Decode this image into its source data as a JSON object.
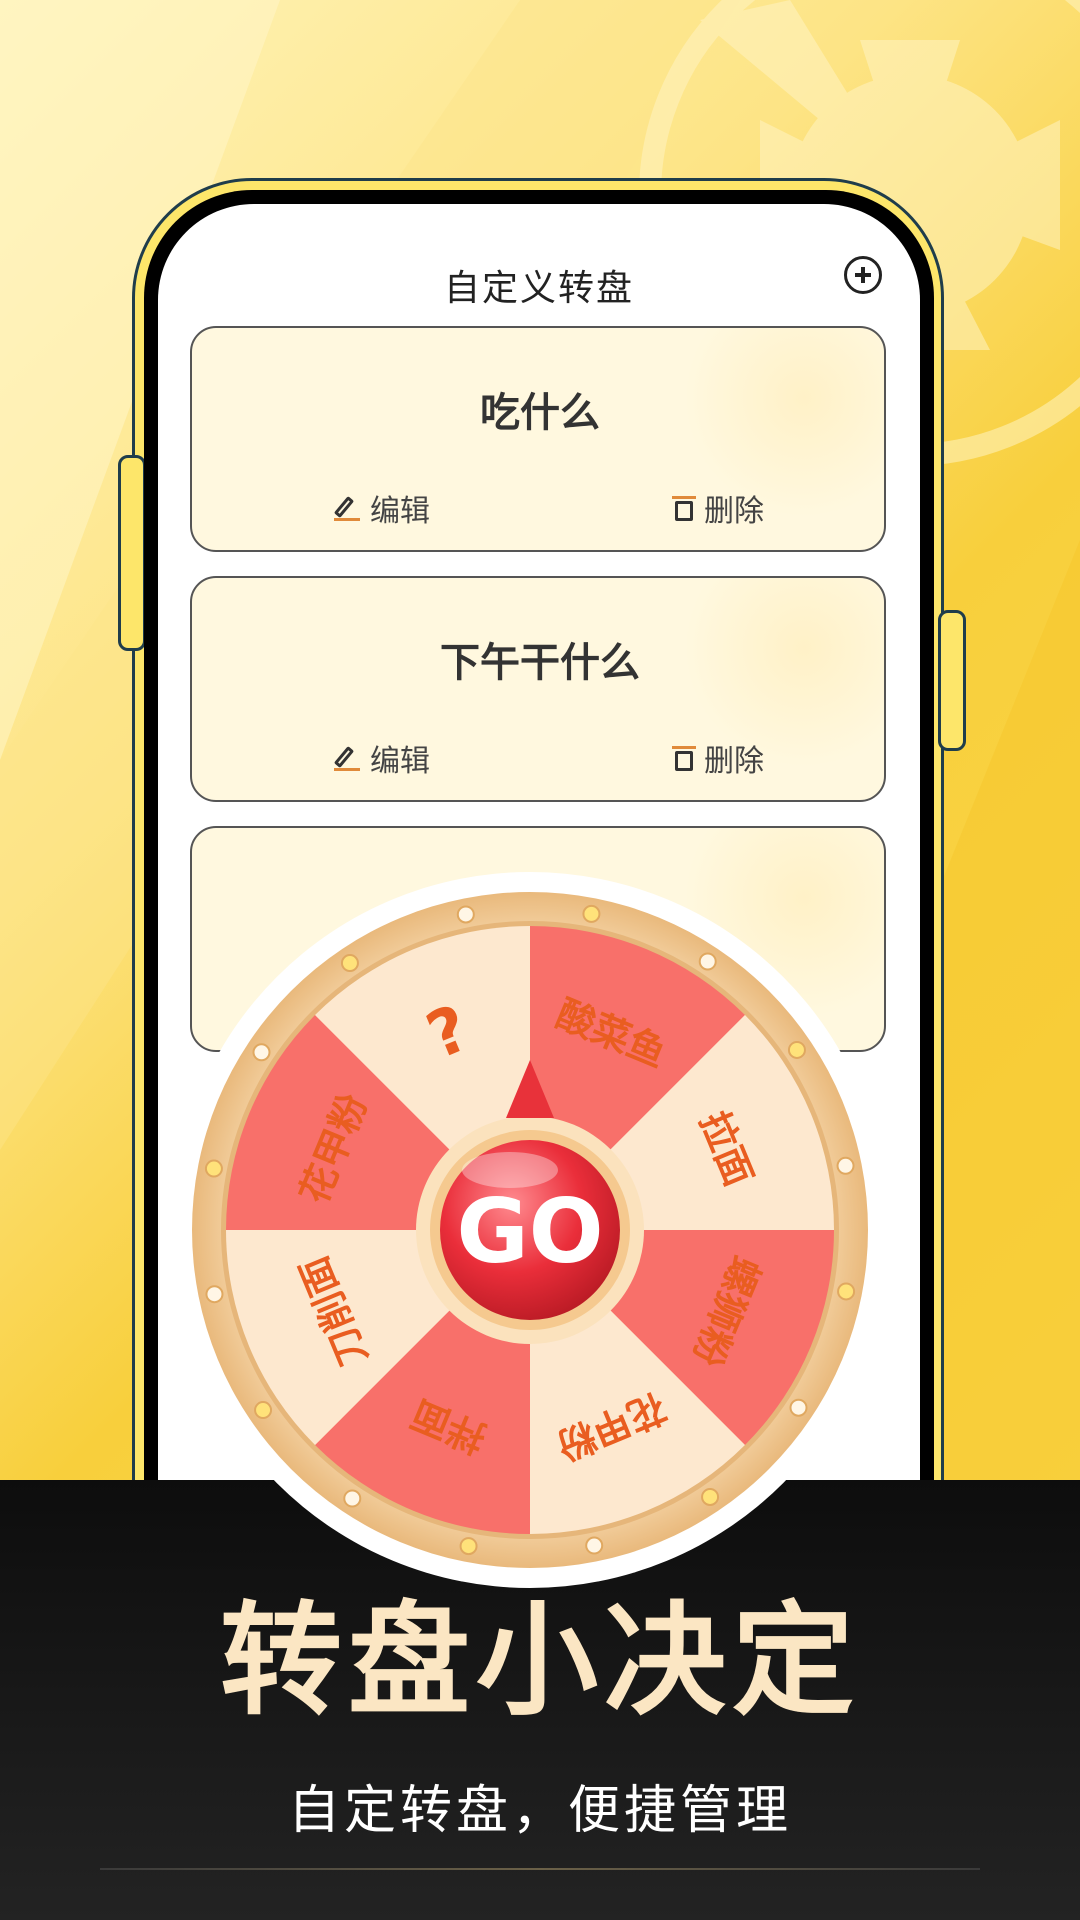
{
  "colors": {
    "accent": "#f8cf3c",
    "card_bg": "#fff8df",
    "wheel_red": "#f8706a",
    "wheel_cream": "#fde8cf",
    "wheel_text": "#e95d20",
    "go_button": "#e8323a",
    "headline": "#fbe6c3"
  },
  "header": {
    "title": "自定义转盘",
    "add_icon": "plus-circle-icon"
  },
  "cards": [
    {
      "title": "吃什么",
      "edit_label": "编辑",
      "delete_label": "删除"
    },
    {
      "title": "下午干什么",
      "edit_label": "编辑",
      "delete_label": "删除"
    },
    {
      "title": "",
      "edit_label": "",
      "delete_label": ""
    }
  ],
  "wheel": {
    "go_label": "GO",
    "segments": [
      "酸菜鱼",
      "拉面",
      "螺狮粉",
      "花甲粉",
      "拌面",
      "刀削面",
      "花甲粉",
      "?"
    ]
  },
  "promo": {
    "headline": "转盘小决定",
    "subline": "自定转盘，便捷管理"
  }
}
